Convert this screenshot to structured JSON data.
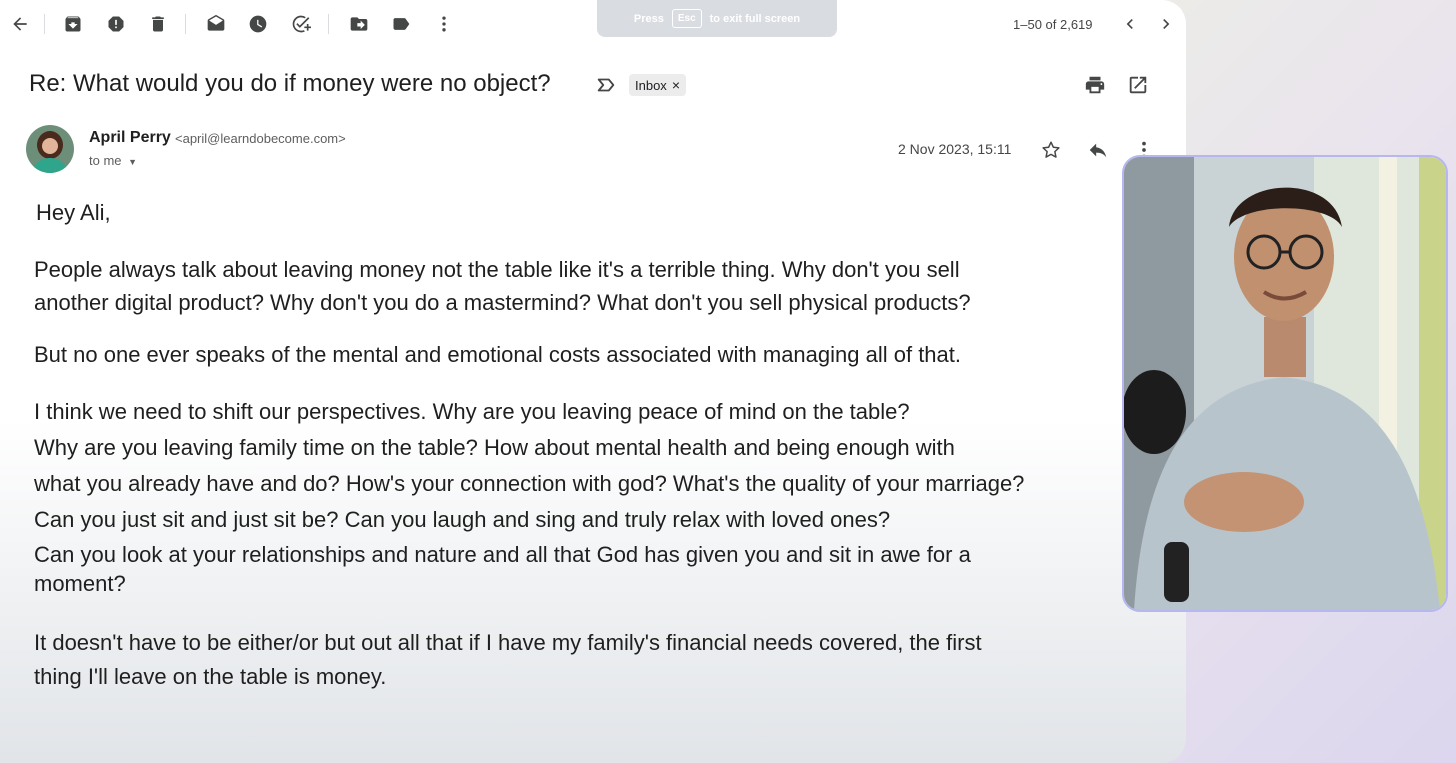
{
  "fullscreen_hint": {
    "press": "Press",
    "key": "Esc",
    "rest": "to exit full screen"
  },
  "toolbar": {
    "icons": [
      "back-icon",
      "archive-icon",
      "report-spam-icon",
      "delete-icon",
      "mark-unread-icon",
      "snooze-icon",
      "add-task-icon",
      "move-to-icon",
      "label-icon",
      "more-icon"
    ]
  },
  "pager": {
    "text": "1–50 of 2,619"
  },
  "email": {
    "subject": "Re: What would you do if money were no object?",
    "label_chip": "Inbox",
    "label_chip_remove": "×",
    "sender_name": "April Perry",
    "sender_email": "<april@learndobecome.com>",
    "recipient": "to me",
    "date": "2 Nov 2023, 15:11",
    "body": [
      "Hey Ali,",
      "People always talk about leaving money not the table like it's a terrible thing. Why don't you sell",
      "another digital product? Why don't you do a mastermind? What don't you sell physical products?",
      "But no one ever speaks of the mental and emotional costs associated with managing all of that.",
      "I think we need to shift our perspectives. Why are you leaving peace of mind on the table?",
      "Why are you leaving family time on the table? How about mental health and being enough with",
      "what you already have and do? How's your connection with god? What's the quality of your marriage?",
      "Can you just sit and just sit be? Can you laugh and sing and truly relax with loved ones?",
      "Can you look at your relationships and nature and all that God has given you and sit in awe for a",
      "moment?",
      "It doesn't have to be either/or but out all that if I have my family's financial needs covered, the first",
      "thing I'll leave on the table is money."
    ]
  },
  "colors": {
    "icon": "#444746",
    "text": "#1f1f1f",
    "video_border": "#b6b6f0"
  }
}
